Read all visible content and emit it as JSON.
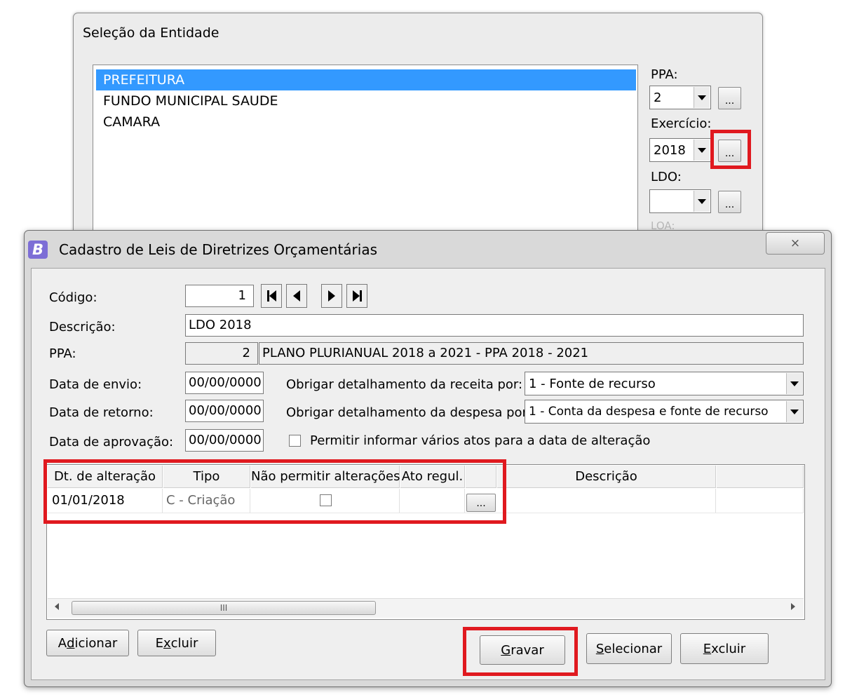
{
  "entity_window": {
    "title": "Seleção da Entidade",
    "entities": [
      {
        "label": "PREFEITURA",
        "selected": true
      },
      {
        "label": "FUNDO MUNICIPAL SAUDE",
        "selected": false
      },
      {
        "label": "CAMARA",
        "selected": false
      }
    ],
    "ppa_label": "PPA:",
    "ppa_value": "2",
    "exercicio_label": "Exercício:",
    "exercicio_value": "2018",
    "ldo_label": "LDO:",
    "ldo_value": "",
    "loa_label": "LOA:",
    "browse_label": "..."
  },
  "dialog": {
    "title": "Cadastro de Leis de Diretrizes Orçamentárias",
    "icon_letter": "B",
    "close_glyph": "⨯",
    "codigo_label": "Código:",
    "codigo_value": "1",
    "descricao_label": "Descrição:",
    "descricao_value": "LDO 2018",
    "ppa_label": "PPA:",
    "ppa_code": "2",
    "ppa_desc": "PLANO PLURIANUAL 2018 a 2021 - PPA 2018 - 2021",
    "data_envio_label": "Data de envio:",
    "data_envio_value": "00/00/0000",
    "data_retorno_label": "Data de retorno:",
    "data_retorno_value": "00/00/0000",
    "data_aprovacao_label": "Data de aprovação:",
    "data_aprovacao_value": "00/00/0000",
    "receita_label": "Obrigar detalhamento da receita por:",
    "receita_value": "1 - Fonte de recurso",
    "despesa_label": "Obrigar detalhamento da despesa por:",
    "despesa_value": "1 - Conta da despesa e fonte de recurso",
    "permitir_label": "Permitir informar vários atos para a data de alteração"
  },
  "grid": {
    "columns": [
      "Dt. de alteração",
      "Tipo",
      "Não permitir alterações",
      "Ato regul.",
      "",
      "Descrição",
      ""
    ],
    "rows": [
      {
        "dt": "01/01/2018",
        "tipo": "C - Criação",
        "nao_permitir": false,
        "ato": "",
        "browse": "...",
        "descricao": ""
      }
    ],
    "scroll_thumb_glyph": "III"
  },
  "buttons": {
    "adicionar_a": "A",
    "adicionar_u": "d",
    "adicionar_b": "icionar",
    "excluir_grid_a": "E",
    "excluir_grid_u": "x",
    "excluir_grid_b": "cluir",
    "gravar_u": "G",
    "gravar_b": "ravar",
    "selecionar_u": "S",
    "selecionar_b": "elecionar",
    "excluir_u": "E",
    "excluir_b": "xcluir"
  },
  "colors": {
    "selection": "#3399ff",
    "highlight_box": "#e0191f",
    "app_icon": "#7d6ed6"
  }
}
